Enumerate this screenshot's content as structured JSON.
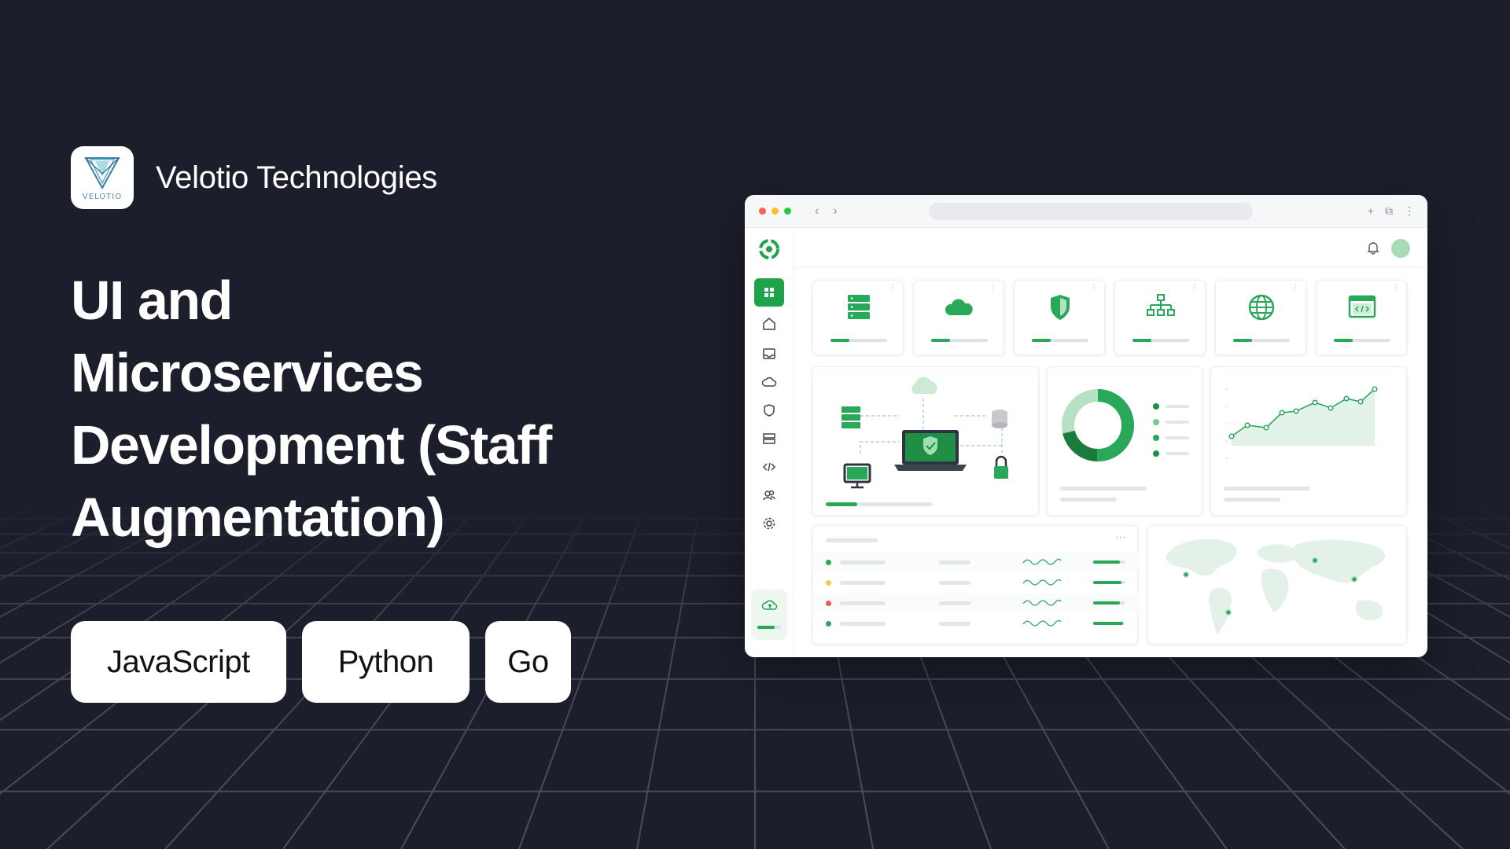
{
  "brand": {
    "name": "Velotio Technologies",
    "logo_word": "VELOTIO",
    "logo_icon": "velotio-logo"
  },
  "headline": {
    "lines": [
      "UI and",
      "Microservices",
      "Development (Staff",
      "Augmentation)"
    ]
  },
  "tags": [
    {
      "label": "JavaScript"
    },
    {
      "label": "Python"
    },
    {
      "label": "Go"
    }
  ],
  "mockup": {
    "window_dots": [
      "#ff5f57",
      "#febc2e",
      "#28c840"
    ],
    "accent": "#1fa34a",
    "light_accent": "#a8dcb5",
    "stat_cards": [
      {
        "icon": "server-icon"
      },
      {
        "icon": "cloud-icon"
      },
      {
        "icon": "shield-icon"
      },
      {
        "icon": "network-icon"
      },
      {
        "icon": "globe-icon"
      },
      {
        "icon": "code-window-icon"
      }
    ],
    "sidebar_icons": [
      "dashboard-icon",
      "home-icon",
      "inbox-icon",
      "cloud-icon",
      "shield-icon",
      "storage-icon",
      "code-icon",
      "users-icon",
      "settings-icon"
    ],
    "list_status_colors": [
      "#2aa85a",
      "#f2c94c",
      "#eb5757",
      "#2aa85a"
    ]
  }
}
